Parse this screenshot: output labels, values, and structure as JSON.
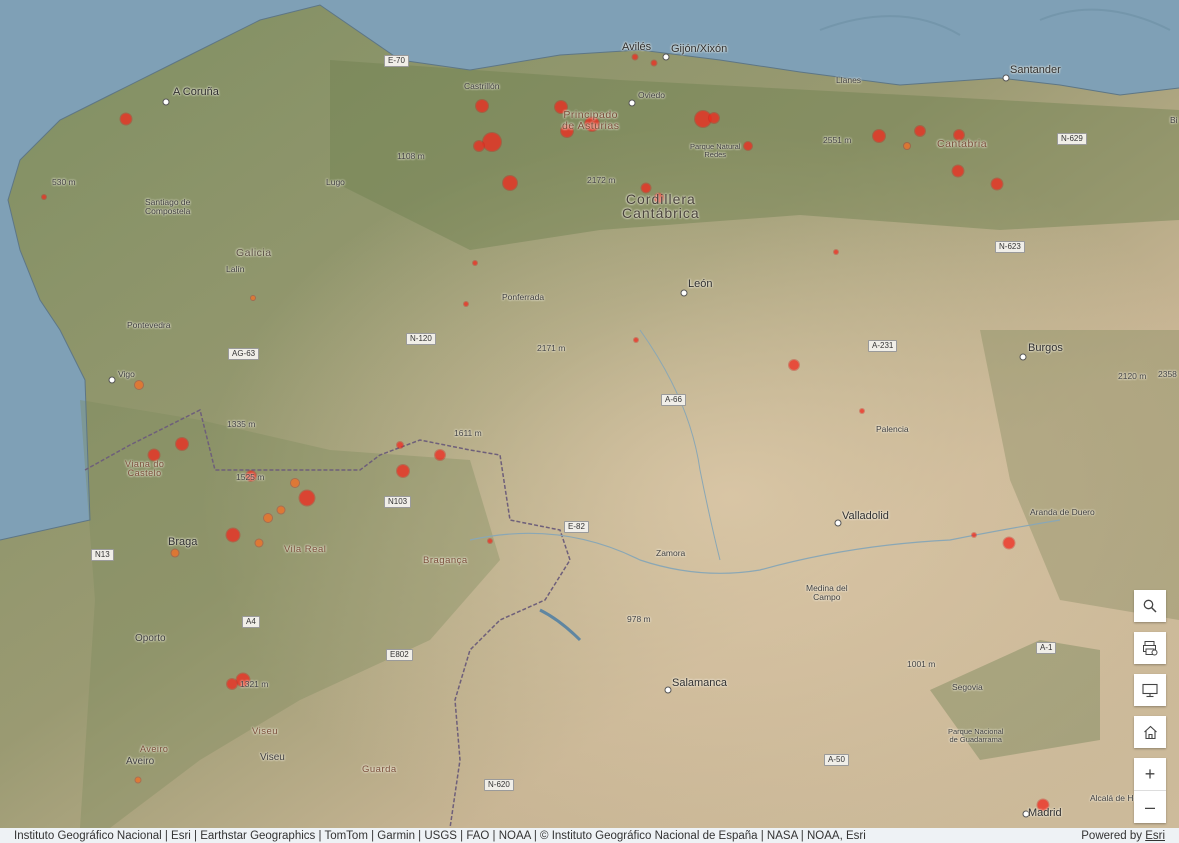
{
  "map": {
    "labels": {
      "a_coruna": "A Coruña",
      "aviles": "Avilés",
      "gijon": "Gijón/Xixón",
      "castrillon": "Castrillón",
      "oviedo": "Oviedo",
      "llanes": "Llanes",
      "santander": "Santander",
      "santiago": "Santiago de\nCompostela",
      "lugo": "Lugo",
      "galicia": "Galicia",
      "lalin": "Lalín",
      "pontevedra": "Pontevedra",
      "vigo": "Vigo",
      "asturias": "Principado\nde Asturias",
      "parque_redes": "Parque Natural\nRedes",
      "cantabria": "Cantabria",
      "cordillera": "Cordillera\nCantábrica",
      "leon": "León",
      "ponferrada": "Ponferrada",
      "burgos": "Burgos",
      "palencia": "Palencia",
      "valladolid": "Valladolid",
      "aranda": "Aranda de Duero",
      "zamora": "Zamora",
      "medina": "Medina del\nCampo",
      "salamanca": "Salamanca",
      "segovia": "Segovia",
      "guadarrama": "Parque Nacional\nde Guadarrama",
      "madrid": "Madrid",
      "alcala": "Alcalá de Henares",
      "viana": "Viana do\nCastelo",
      "braga": "Braga",
      "vila_real": "Vila Real",
      "braganca": "Bragança",
      "oporto": "Oporto",
      "viseu_region": "Viseu",
      "viseu": "Viseu",
      "aveiro_region": "Aveiro",
      "aveiro": "Aveiro",
      "guarda": "Guarda",
      "bi": "Bi"
    },
    "elevations": {
      "e530": "530 m",
      "e1108": "1108 m",
      "e2172": "2172 m",
      "e2551": "2551 m",
      "e2171": "2171 m",
      "e1335": "1335 m",
      "e1525": "1525 m",
      "e1611": "1611 m",
      "e978": "978 m",
      "e1321": "1321 m",
      "e1001": "1001 m",
      "e2120": "2120 m",
      "e2358": "2358"
    },
    "roads": {
      "e70": "E-70",
      "n629": "N-629",
      "n623": "N-623",
      "ag63": "AG-63",
      "n120": "N-120",
      "a231": "A-231",
      "a66": "A-66",
      "n103": "N103",
      "e82": "E-82",
      "n13": "N13",
      "a4": "A4",
      "e802": "E802",
      "a1": "A-1",
      "n620": "N-620",
      "a50": "A-50"
    }
  },
  "widgets": {
    "search_icon": "search-icon",
    "print_icon": "print-icon",
    "fullscreen_icon": "monitor-icon",
    "home_icon": "home-icon",
    "zoom_in": "+",
    "zoom_out": "–"
  },
  "attribution": {
    "text": "Instituto Geográfico Nacional | Esri | Earthstar Geographics | TomTom | Garmin | USGS | FAO | NOAA | © Instituto Geográfico Nacional de España | NASA | NOAA, Esri",
    "powered_by": "Powered by",
    "esri": "Esri"
  },
  "colors": {
    "sea": "#7fa0b6",
    "fire_marker": "#f0281e",
    "fire_marker_alt": "#f56e23"
  }
}
